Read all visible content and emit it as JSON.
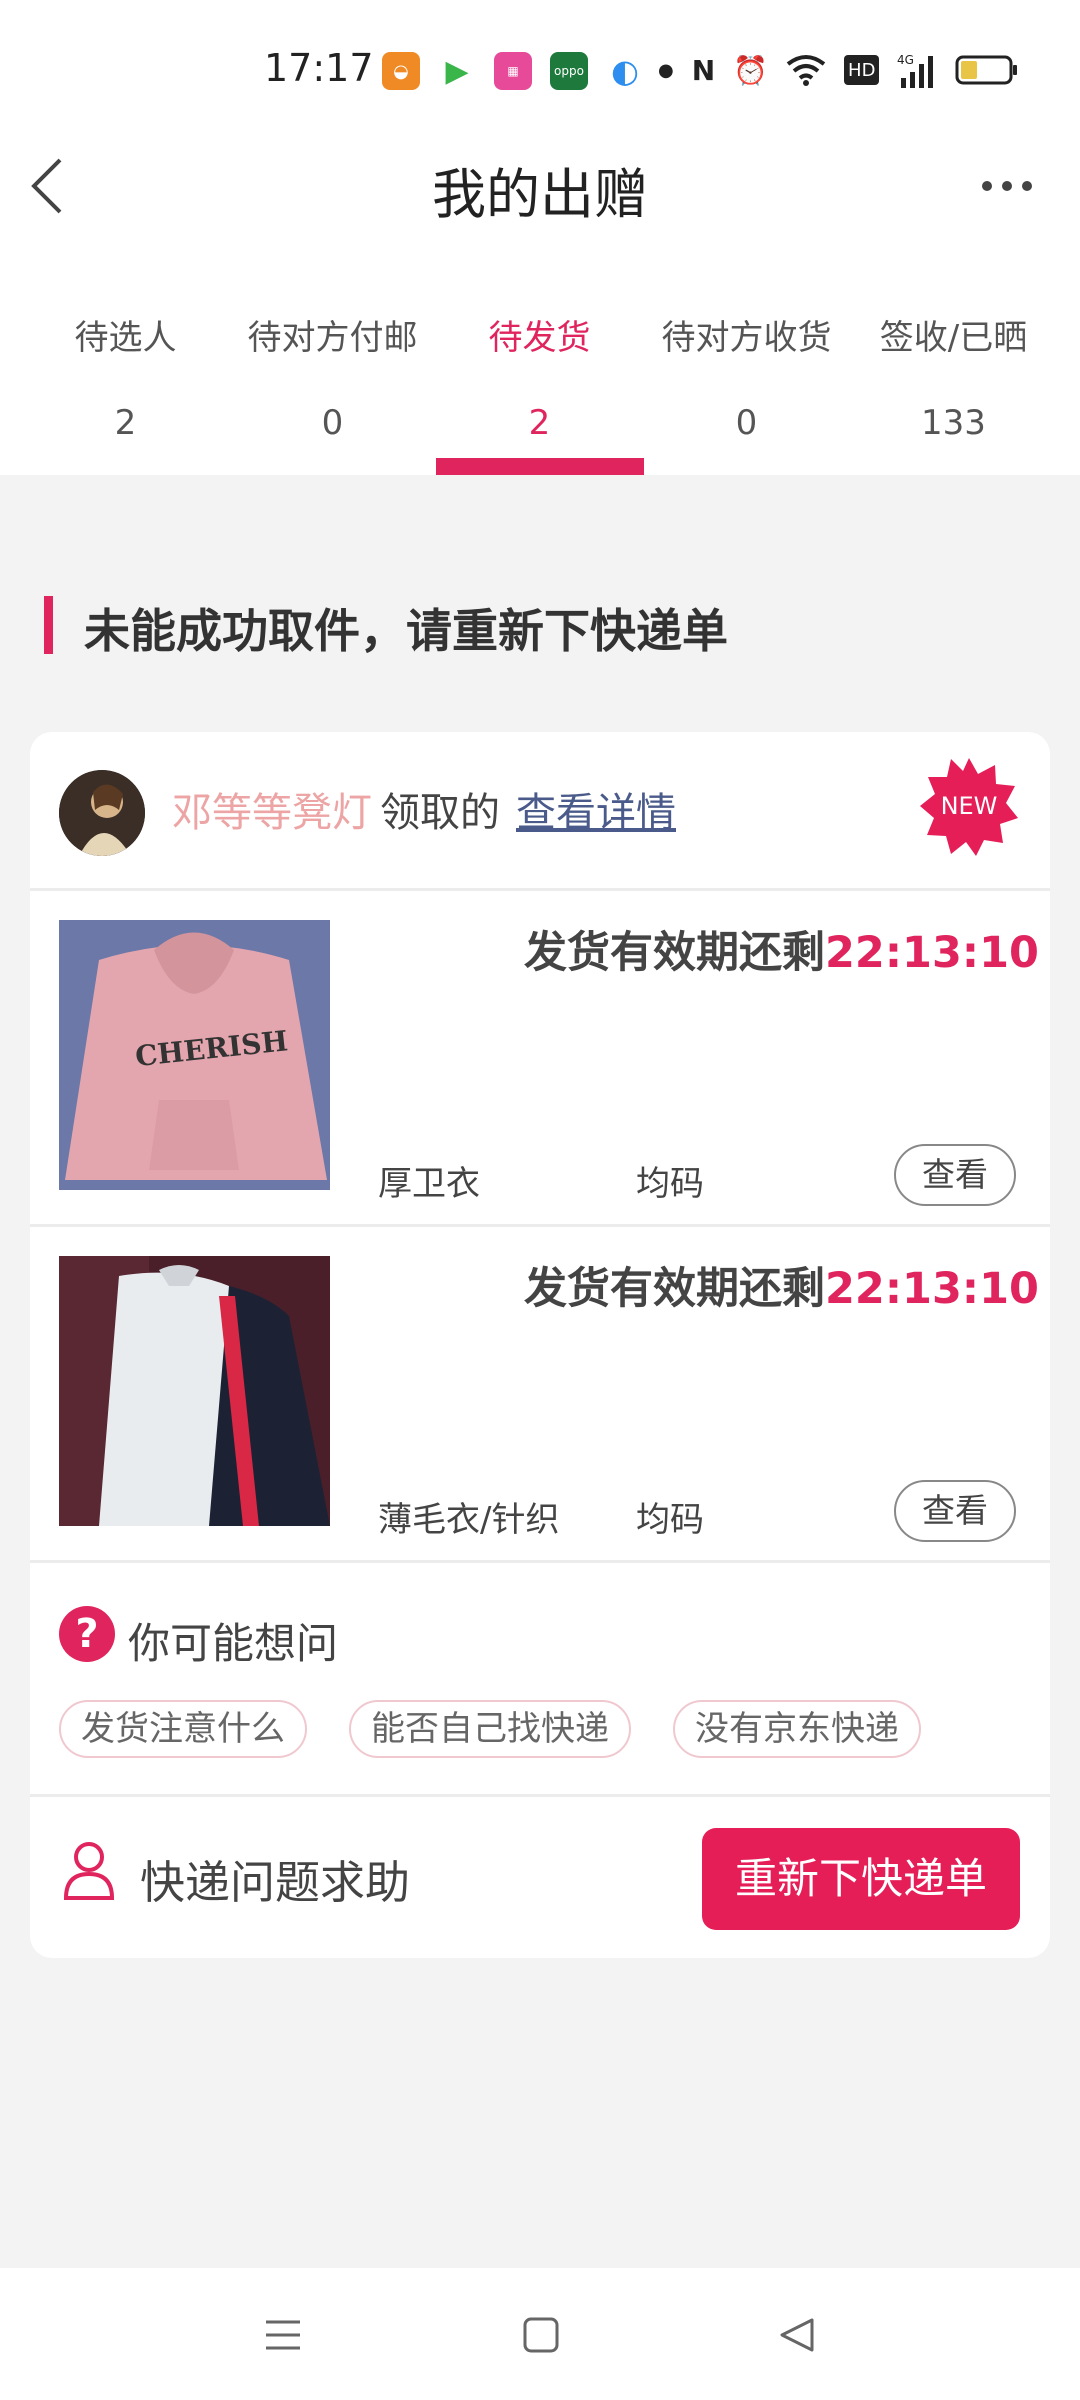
{
  "status_bar": {
    "time": "17:17",
    "icons": [
      "app-orange-icon",
      "video-play-icon",
      "shopping-icon",
      "oppo-icon",
      "browser-icon",
      "dot-icon",
      "nfc-icon",
      "alarm-icon",
      "wifi-icon",
      "hd-icon",
      "signal-4g-icon",
      "battery-icon"
    ]
  },
  "header": {
    "title": "我的出赠"
  },
  "tabs": [
    {
      "label": "待选人",
      "count": "2"
    },
    {
      "label": "待对方付邮",
      "count": "0"
    },
    {
      "label": "待发货",
      "count": "2",
      "active": true
    },
    {
      "label": "待对方收货",
      "count": "0"
    },
    {
      "label": "签收/已晒",
      "count": "133"
    }
  ],
  "section": {
    "title": "未能成功取件，请重新下快递单"
  },
  "card": {
    "claimer_name": "邓等等凳灯",
    "claim_suffix": "领取的",
    "detail_link": "查看详情",
    "new_badge": "NEW",
    "items": [
      {
        "deadline_label": "发货有效期还剩",
        "timer": "22:13:10",
        "name": "厚卫衣",
        "size": "均码",
        "view_label": "查看",
        "image_text": "CHERISH"
      },
      {
        "deadline_label": "发货有效期还剩",
        "timer": "22:13:10",
        "name": "薄毛衣/针织",
        "size": "均码",
        "view_label": "查看"
      }
    ],
    "faq": {
      "title": "你可能想问",
      "chips": [
        "发货注意什么",
        "能否自己找快递",
        "没有京东快递"
      ]
    },
    "help_text": "快递问题求助",
    "resend_button": "重新下快递单"
  },
  "colors": {
    "accent": "#e0245e",
    "button": "#e51e57",
    "claimer_name": "#eda4a4",
    "link": "#4a5a8a"
  }
}
